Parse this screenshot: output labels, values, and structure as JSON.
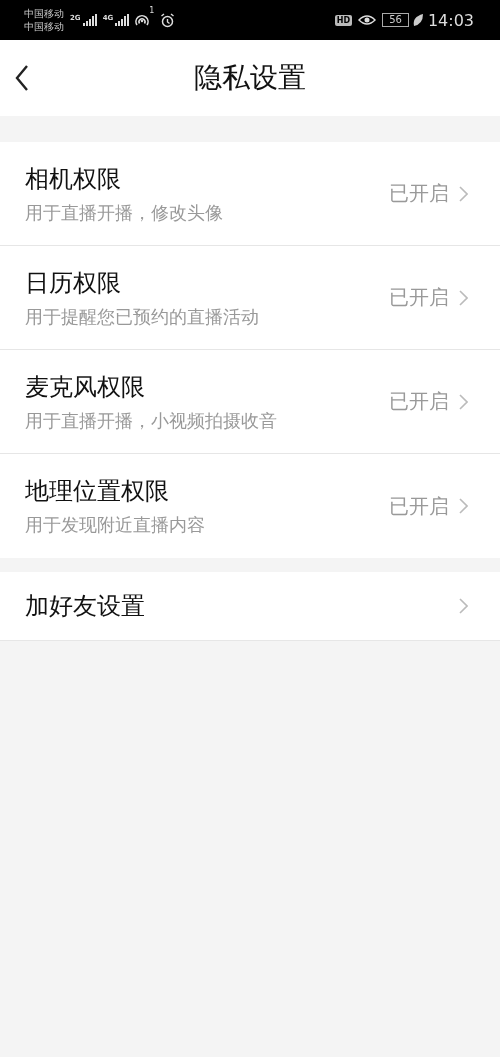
{
  "status_bar": {
    "carriers": [
      "中国移动",
      "中国移动"
    ],
    "network_labels": [
      "2G",
      "4G"
    ],
    "hotspot_count": "1",
    "hd_label": "HD",
    "battery": "56",
    "time": "14:03"
  },
  "header": {
    "title": "隐私设置"
  },
  "permissions": [
    {
      "title": "相机权限",
      "description": "用于直播开播，修改头像",
      "status": "已开启"
    },
    {
      "title": "日历权限",
      "description": "用于提醒您已预约的直播活动",
      "status": "已开启"
    },
    {
      "title": "麦克风权限",
      "description": "用于直播开播，小视频拍摄收音",
      "status": "已开启"
    },
    {
      "title": "地理位置权限",
      "description": "用于发现附近直播内容",
      "status": "已开启"
    }
  ],
  "other_settings": [
    {
      "title": "加好友设置"
    }
  ]
}
